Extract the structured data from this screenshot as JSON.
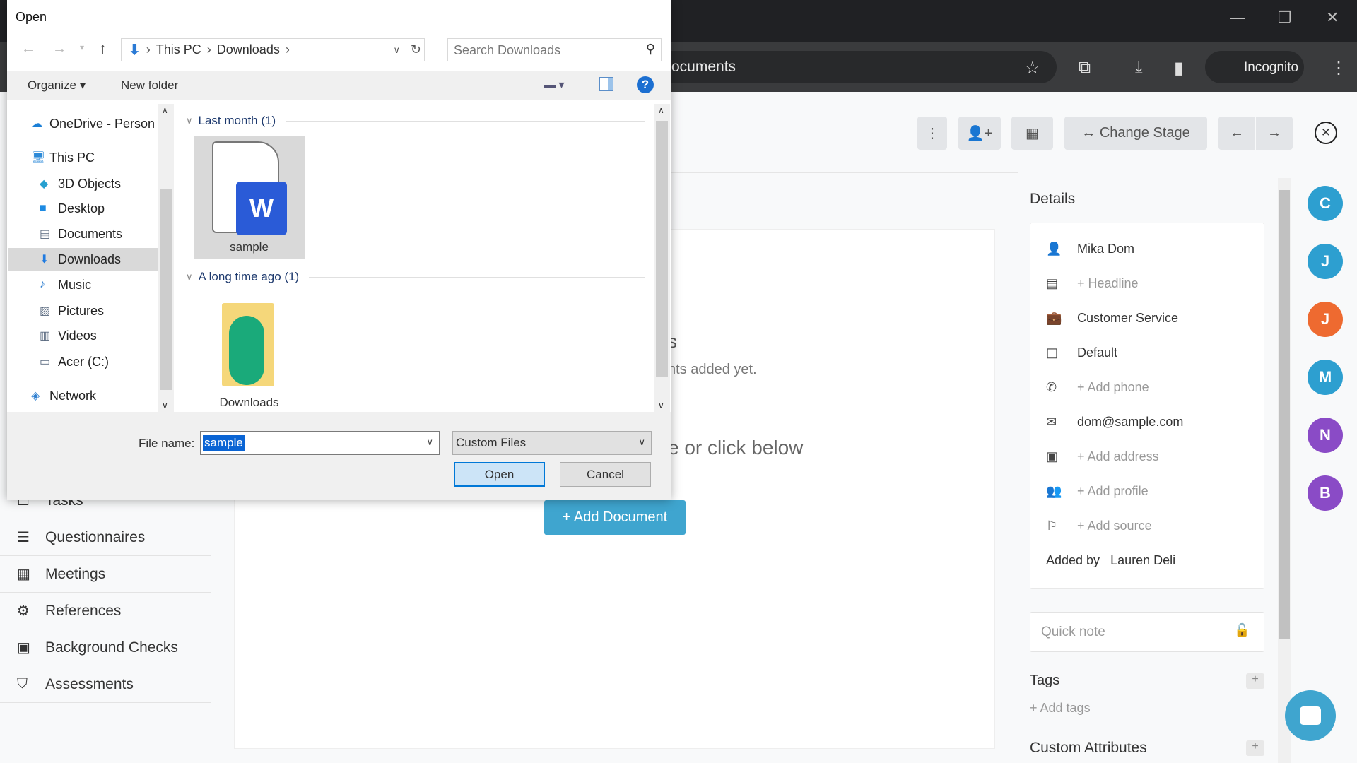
{
  "browser": {
    "address_partial": "ocuments",
    "incognito_label": "Incognito"
  },
  "actions": {
    "change_stage": "Change Stage"
  },
  "sidebar": {
    "items": [
      {
        "label": "Tasks",
        "icon": "checkbox-icon"
      },
      {
        "label": "Questionnaires",
        "icon": "list-icon"
      },
      {
        "label": "Meetings",
        "icon": "calendar-icon"
      },
      {
        "label": "References",
        "icon": "gear-icon"
      },
      {
        "label": "Background Checks",
        "icon": "id-card-icon"
      },
      {
        "label": "Assessments",
        "icon": "shield-icon"
      }
    ]
  },
  "main": {
    "heading_partial": "s",
    "empty_text_partial": "nts added yet.",
    "drop_text_partial": "e or click below",
    "add_document": "+ Add Document"
  },
  "details": {
    "title": "Details",
    "rows": [
      {
        "icon": "person-icon",
        "text": "Mika Dom",
        "muted": false
      },
      {
        "icon": "newspaper-icon",
        "text": "+ Headline",
        "muted": true
      },
      {
        "icon": "briefcase-icon",
        "text": "Customer Service",
        "muted": false
      },
      {
        "icon": "table-icon",
        "text": "Default",
        "muted": false
      },
      {
        "icon": "phone-icon",
        "text": "+ Add phone",
        "muted": true
      },
      {
        "icon": "mail-icon",
        "text": "dom@sample.com",
        "muted": false
      },
      {
        "icon": "address-card-icon",
        "text": "+ Add address",
        "muted": true
      },
      {
        "icon": "users-icon",
        "text": "+ Add profile",
        "muted": true
      },
      {
        "icon": "flag-icon",
        "text": "+ Add source",
        "muted": true
      }
    ],
    "added_by_label": "Added by",
    "added_by": "Lauren Deli",
    "quick_note_placeholder": "Quick note",
    "tags_title": "Tags",
    "add_tags": "+ Add tags",
    "custom_attributes_title": "Custom Attributes"
  },
  "avatars": [
    {
      "letter": "C",
      "color": "#2d9fd0"
    },
    {
      "letter": "J",
      "color": "#2d9fd0"
    },
    {
      "letter": "J",
      "color": "#ee6a30"
    },
    {
      "letter": "M",
      "color": "#2d9fd0"
    },
    {
      "letter": "N",
      "color": "#8a4bc6"
    },
    {
      "letter": "B",
      "color": "#8a4bc6"
    }
  ],
  "dialog": {
    "title": "Open",
    "breadcrumb": [
      "This PC",
      "Downloads"
    ],
    "search_placeholder": "Search Downloads",
    "organize": "Organize",
    "new_folder": "New folder",
    "nav": [
      {
        "label": "OneDrive - Person",
        "icon": "cloud-icon",
        "indent": 0
      },
      {
        "label": "This PC",
        "icon": "computer-icon",
        "indent": 0
      },
      {
        "label": "3D Objects",
        "icon": "cube-icon",
        "indent": 1
      },
      {
        "label": "Desktop",
        "icon": "desktop-icon",
        "indent": 1
      },
      {
        "label": "Documents",
        "icon": "document-icon",
        "indent": 1
      },
      {
        "label": "Downloads",
        "icon": "download-icon",
        "indent": 1,
        "selected": true
      },
      {
        "label": "Music",
        "icon": "music-icon",
        "indent": 1
      },
      {
        "label": "Pictures",
        "icon": "picture-icon",
        "indent": 1
      },
      {
        "label": "Videos",
        "icon": "video-icon",
        "indent": 1
      },
      {
        "label": "Acer (C:)",
        "icon": "drive-icon",
        "indent": 1
      },
      {
        "label": "Network",
        "icon": "network-icon",
        "indent": 0
      }
    ],
    "groups": [
      {
        "label": "Last month (1)",
        "file": "sample"
      },
      {
        "label": "A long time ago (1)",
        "file": "Downloads"
      }
    ],
    "file_name_label": "File name:",
    "file_name_value": "sample",
    "file_type": "Custom Files",
    "open": "Open",
    "cancel": "Cancel"
  }
}
